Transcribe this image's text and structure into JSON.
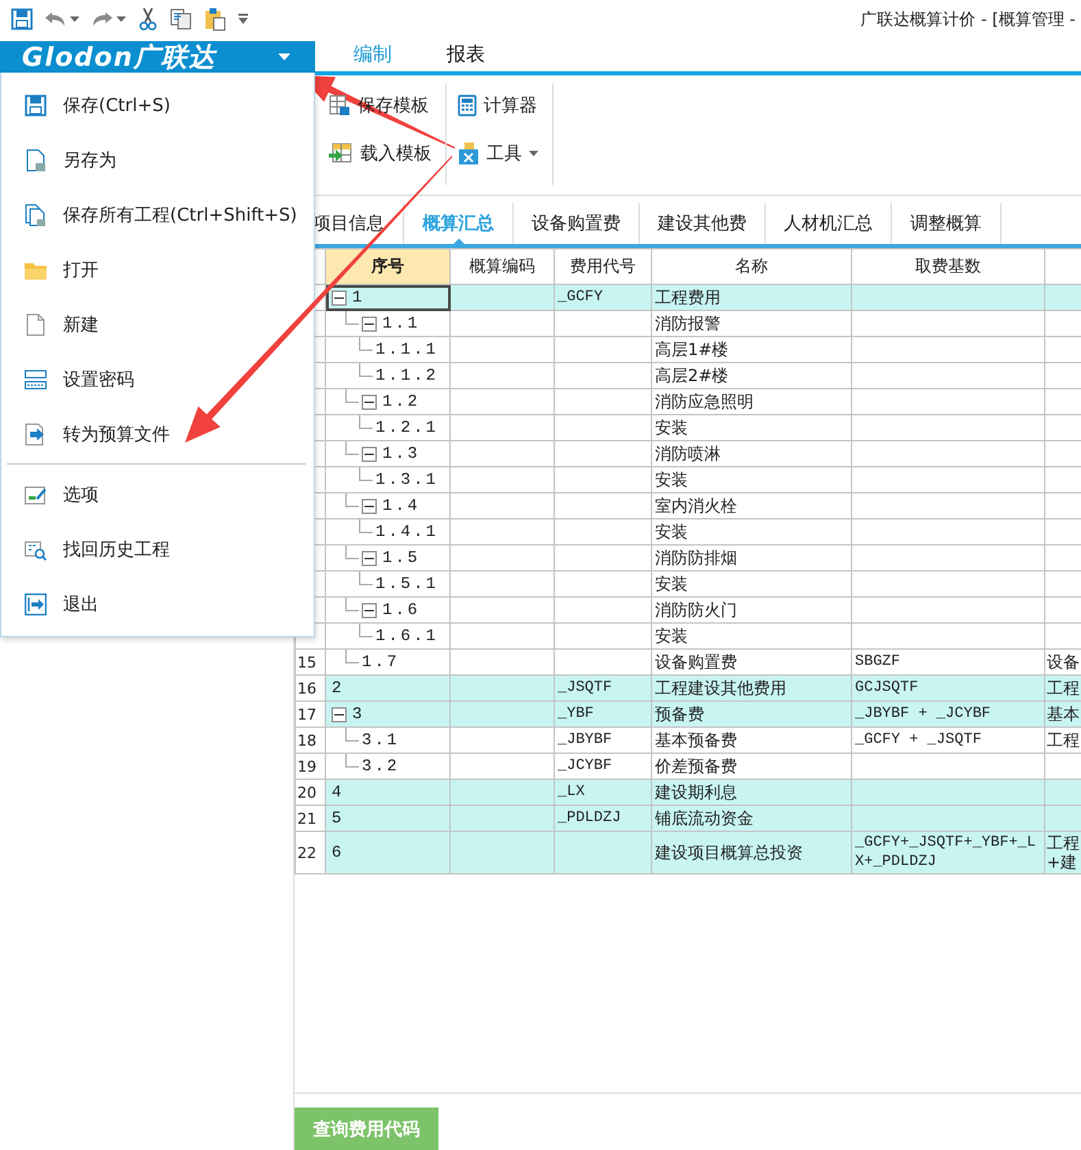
{
  "window": {
    "title": "广联达概算计价 - [概算管理 -"
  },
  "app_button": {
    "label": "Glodon广联达"
  },
  "ribbon_tabs": [
    {
      "label": "编制",
      "selected": true
    },
    {
      "label": "报表",
      "selected": false
    }
  ],
  "ribbon_groups": [
    [
      {
        "label": "保存模板",
        "dropdown": false
      },
      {
        "label": "载入模板",
        "dropdown": false
      }
    ],
    [
      {
        "label": "计算器",
        "dropdown": false
      },
      {
        "label": "工具",
        "dropdown": true
      }
    ]
  ],
  "sheet_tabs": [
    {
      "label": "项目信息",
      "selected": false
    },
    {
      "label": "概算汇总",
      "selected": true
    },
    {
      "label": "设备购置费",
      "selected": false
    },
    {
      "label": "建设其他费",
      "selected": false
    },
    {
      "label": "人材机汇总",
      "selected": false
    },
    {
      "label": "调整概算",
      "selected": false
    }
  ],
  "table": {
    "columns": [
      {
        "label": "序号",
        "selected": true
      },
      {
        "label": "概算编码",
        "selected": false
      },
      {
        "label": "费用代号",
        "selected": false
      },
      {
        "label": "名称",
        "selected": false
      },
      {
        "label": "取费基数",
        "selected": false
      }
    ],
    "rows": [
      {
        "seq": "1",
        "fee_code": "_GCFY",
        "name": "工程费用",
        "selected": true,
        "expanded": true,
        "children": [
          {
            "seq": "1.1",
            "name": "消防报警",
            "selected": false,
            "expanded": true,
            "children": [
              {
                "seq": "1.1.1",
                "name": "高层1#楼",
                "selected": false
              },
              {
                "seq": "1.1.2",
                "name": "高层2#楼",
                "selected": false
              }
            ]
          },
          {
            "seq": "1.2",
            "name": "消防应急照明",
            "selected": false,
            "expanded": true,
            "children": [
              {
                "seq": "1.2.1",
                "name": "安装",
                "selected": false
              }
            ]
          },
          {
            "seq": "1.3",
            "name": "消防喷淋",
            "selected": false,
            "expanded": true,
            "children": [
              {
                "seq": "1.3.1",
                "name": "安装",
                "selected": false
              }
            ]
          },
          {
            "seq": "1.4",
            "name": "室内消火栓",
            "selected": false,
            "expanded": true,
            "children": [
              {
                "seq": "1.4.1",
                "name": "安装",
                "selected": false
              }
            ]
          },
          {
            "seq": "1.5",
            "name": "消防防排烟",
            "selected": false,
            "expanded": true,
            "children": [
              {
                "seq": "1.5.1",
                "name": "安装",
                "selected": false
              }
            ]
          },
          {
            "seq": "1.6",
            "name": "消防防火门",
            "selected": false,
            "expanded": true,
            "children": [
              {
                "seq": "1.6.1",
                "name": "安装",
                "selected": false
              }
            ]
          },
          {
            "num": "15",
            "seq": "1.7",
            "name": "设备购置费",
            "base": "SBGZF",
            "column_6": "设备",
            "selected": false
          }
        ]
      },
      {
        "num": "16",
        "seq": "2",
        "fee_code": "_JSQTF",
        "name": "工程建设其他费用",
        "base": "GCJSQTF",
        "column_6": "工程",
        "selected": false
      },
      {
        "num": "17",
        "seq": "3",
        "fee_code": "_YBF",
        "name": "预备费",
        "base": "_JBYBF + _JCYBF",
        "column_6": "基本",
        "selected": false,
        "expanded": true,
        "children": [
          {
            "num": "18",
            "seq": "3.1",
            "fee_code": "_JBYBF",
            "name": "基本预备费",
            "base": "_GCFY + _JSQTF",
            "column_6": "工程",
            "selected": false
          },
          {
            "num": "19",
            "seq": "3.2",
            "fee_code": "_JCYBF",
            "name": "价差预备费",
            "selected": false
          }
        ]
      },
      {
        "num": "20",
        "seq": "4",
        "fee_code": "_LX",
        "name": "建设期利息",
        "selected": false
      },
      {
        "num": "21",
        "seq": "5",
        "fee_code": "_PDLDZJ",
        "name": "铺底流动资金",
        "selected": false
      },
      {
        "num": "22",
        "seq": "6",
        "name": "建设项目概算总投资",
        "base": "_GCFY+_JSQTF+_YBF+_LX+_PDLDZJ",
        "column_6": "工程+建",
        "selected": false
      }
    ]
  },
  "bottom_button": {
    "label": "查询费用代码"
  },
  "file_menu": {
    "groups": [
      [
        {
          "label": "保存(Ctrl+S)"
        },
        {
          "label": "另存为"
        },
        {
          "label": "保存所有工程(Ctrl+Shift+S)"
        },
        {
          "label": "打开"
        },
        {
          "label": "新建"
        },
        {
          "label": "设置密码"
        },
        {
          "label": "转为预算文件"
        }
      ],
      [
        {
          "label": "选项"
        },
        {
          "label": "找回历史工程"
        },
        {
          "label": "退出"
        }
      ]
    ]
  }
}
